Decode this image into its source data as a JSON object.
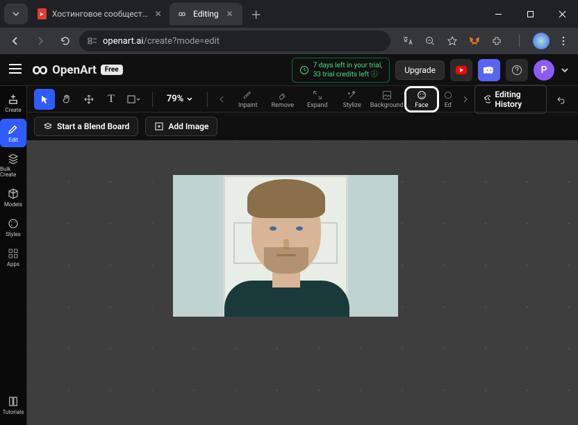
{
  "browser": {
    "tabs": [
      {
        "title": "Хостинговое сообщество «Tim",
        "favicon_color": "#e53935"
      },
      {
        "title": "Editing",
        "favicon_char": "∞"
      }
    ],
    "url_host": "openart.ai",
    "url_path": "/create?mode=edit"
  },
  "header": {
    "brand": "OpenArt",
    "badge": "Free",
    "trial_line1": "7 days left in your trial,",
    "trial_line2": "33 trial credits left",
    "upgrade": "Upgrade",
    "avatar_initial": "P"
  },
  "left_rail": {
    "create": "Create",
    "edit": "Edit",
    "bulk_create": "Bulk Create",
    "models": "Models",
    "styles": "Styles",
    "apps": "Apps",
    "tutorials": "Tutorials"
  },
  "toolbar": {
    "zoom": "79%",
    "ai_tools": {
      "inpaint": "Inpaint",
      "remove": "Remove",
      "expand": "Expand",
      "stylize": "Stylize",
      "background": "Background",
      "face": "Face",
      "ed": "Ed"
    },
    "history": "Editing History"
  },
  "actions": {
    "blend_board": "Start a Blend Board",
    "add_image": "Add Image"
  }
}
